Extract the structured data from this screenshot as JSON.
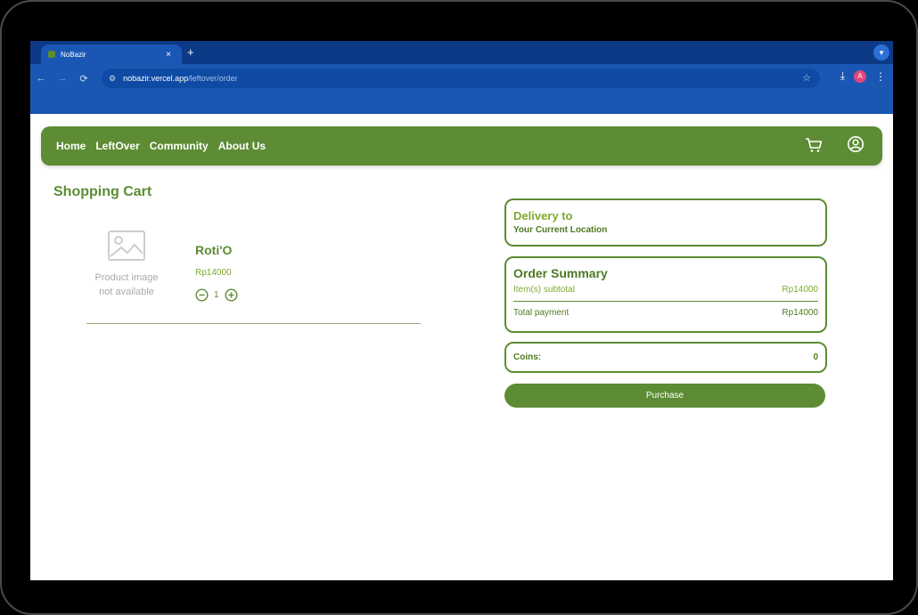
{
  "browser": {
    "tab_title": "NoBazir",
    "tab_close": "×",
    "new_tab": "+",
    "url_host": "nobazir.vercel.app",
    "url_path": "/leftover/order",
    "avatar_letter": "A"
  },
  "navbar": {
    "links": [
      "Home",
      "LeftOver",
      "Community",
      "About Us"
    ]
  },
  "cart": {
    "title": "Shopping Cart",
    "item": {
      "placeholder_line1": "Product image",
      "placeholder_line2": "not available",
      "name": "Roti'O",
      "price": "Rp14000",
      "quantity": "1"
    }
  },
  "delivery": {
    "heading": "Delivery to",
    "location": "Your Current Location"
  },
  "summary": {
    "heading": "Order Summary",
    "subtotal_label": "Item(s) subtotal",
    "subtotal_value": "Rp14000",
    "total_label": "Total payment",
    "total_value": "Rp14000"
  },
  "coins": {
    "label": "Coins:",
    "value": "0"
  },
  "purchase_label": "Purchase",
  "colors": {
    "brand_green": "#5d8c34",
    "accent_green": "#7cab2f",
    "browser_blue": "#1a57b4"
  }
}
